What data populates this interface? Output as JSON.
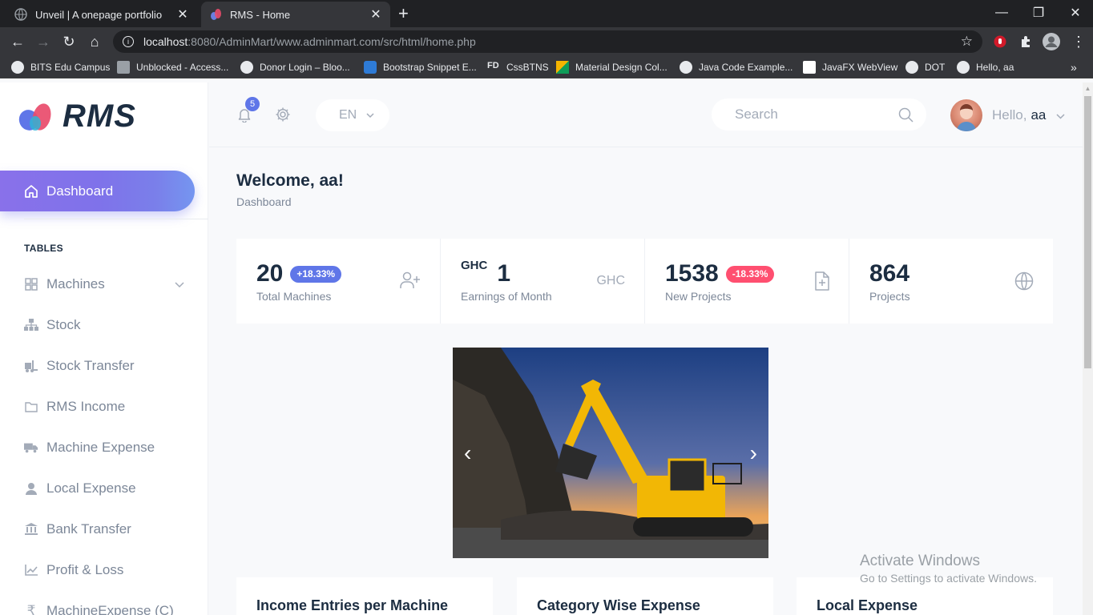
{
  "browser": {
    "tabs": [
      {
        "title": "Unveil | A onepage portfolio",
        "active": false
      },
      {
        "title": "RMS - Home",
        "active": true
      }
    ],
    "url_host": "localhost",
    "url_rest": ":8080/AdminMart/www.adminmart.com/src/html/home.php",
    "bookmarks": [
      {
        "label": "BITS Edu Campus"
      },
      {
        "label": "Unblocked - Access..."
      },
      {
        "label": "Donor Login – Bloo..."
      },
      {
        "label": "Bootstrap Snippet E..."
      },
      {
        "label": "CssBTNS"
      },
      {
        "label": "Material Design Col..."
      },
      {
        "label": "Java Code Example..."
      },
      {
        "label": "JavaFX WebView"
      },
      {
        "label": "DOT"
      },
      {
        "label": "Hello, aa"
      }
    ]
  },
  "app": {
    "logo_text": "RMS",
    "topbar": {
      "notification_count": "5",
      "language": "EN",
      "search_placeholder": "Search",
      "greeting": "Hello,",
      "username": "aa"
    },
    "sidebar": {
      "active_item": "Dashboard",
      "section_title": "TABLES",
      "items": [
        {
          "label": "Machines",
          "icon": "grid-icon",
          "has_submenu": true
        },
        {
          "label": "Stock",
          "icon": "sitemap-icon"
        },
        {
          "label": "Stock Transfer",
          "icon": "forklift-icon"
        },
        {
          "label": "RMS Income",
          "icon": "folder-icon"
        },
        {
          "label": "Machine Expense",
          "icon": "truck-icon"
        },
        {
          "label": "Local Expense",
          "icon": "user-icon"
        },
        {
          "label": "Bank Transfer",
          "icon": "bank-icon"
        },
        {
          "label": "Profit & Loss",
          "icon": "chart-line-icon"
        },
        {
          "label": "MachineExpense (C)",
          "icon": "rupee-icon"
        }
      ]
    },
    "main": {
      "welcome": "Welcome, aa!",
      "breadcrumb": "Dashboard",
      "stats": [
        {
          "value": "20",
          "badge": "+18.33%",
          "badge_type": "up",
          "label": "Total Machines",
          "icon": "user-plus-icon"
        },
        {
          "currency": "GHC",
          "value": "1",
          "label": "Earnings of Month",
          "icon_text": "GHC"
        },
        {
          "value": "1538",
          "badge": "-18.33%",
          "badge_type": "down",
          "label": "New Projects",
          "icon": "file-plus-icon"
        },
        {
          "value": "864",
          "label": "Projects",
          "icon": "globe-icon"
        }
      ],
      "carousel": {
        "prev": "‹",
        "next": "›"
      },
      "cards": [
        {
          "title": "Income Entries per Machine"
        },
        {
          "title": "Category Wise Expense"
        },
        {
          "title": "Local Expense"
        }
      ]
    },
    "os_watermark": {
      "line1": "Activate Windows",
      "line2": "Go to Settings to activate Windows."
    }
  },
  "colors": {
    "accent": "#5f76e8",
    "danger": "#ff4f70",
    "heading": "#1c2d41",
    "muted": "#7c8798"
  }
}
